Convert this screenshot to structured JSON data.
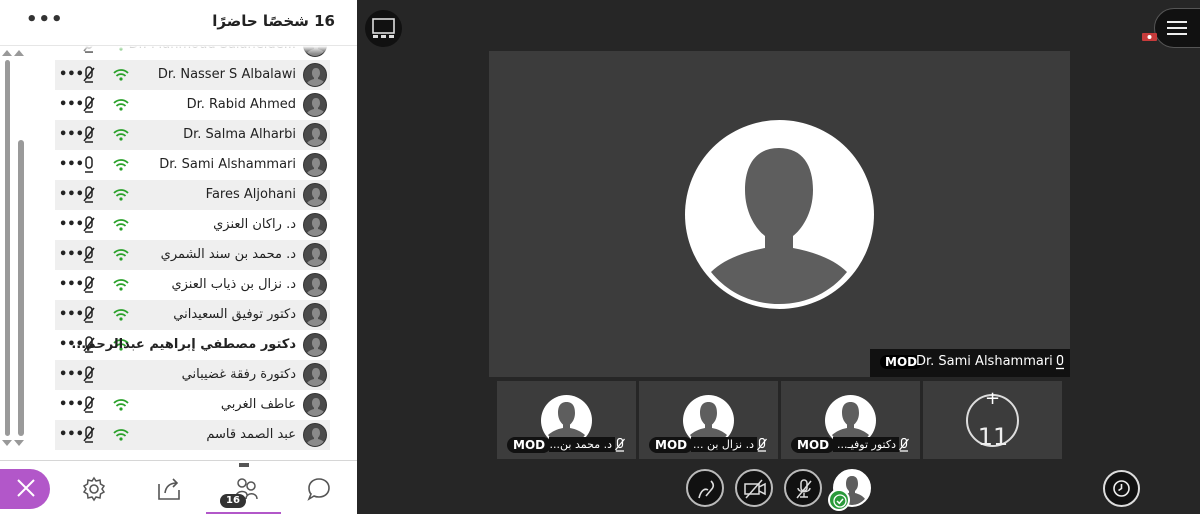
{
  "panel": {
    "title": "16 شخصًا حاضرًا",
    "more_label": "•••",
    "participants": [
      {
        "name": "Dr. Mahmoud Salahelde...",
        "rtl": false,
        "bold": false,
        "wifi": "green"
      },
      {
        "name": "Dr. Nasser S Albalawi",
        "rtl": false,
        "bold": false,
        "wifi": "green"
      },
      {
        "name": "Dr. Rabid Ahmed",
        "rtl": false,
        "bold": false,
        "wifi": "green"
      },
      {
        "name": "Dr. Salma Alharbi",
        "rtl": false,
        "bold": false,
        "wifi": "green"
      },
      {
        "name": "Dr. Sami Alshammari",
        "rtl": false,
        "bold": false,
        "wifi": "green",
        "mic_on": true
      },
      {
        "name": "Fares Aljohani",
        "rtl": false,
        "bold": false,
        "wifi": "green"
      },
      {
        "name": "د. راكان العنزي",
        "rtl": true,
        "bold": false,
        "wifi": "green"
      },
      {
        "name": "د. محمد بن سند الشمري",
        "rtl": true,
        "bold": false,
        "wifi": "green"
      },
      {
        "name": "د. نزال بن ذياب العنزي",
        "rtl": true,
        "bold": false,
        "wifi": "green"
      },
      {
        "name": "دكتور توفيق السعيداني",
        "rtl": true,
        "bold": false,
        "wifi": "green"
      },
      {
        "name": "دكتور مصطفي إبراهيم عبدالرحم...",
        "rtl": true,
        "bold": true,
        "wifi": "green"
      },
      {
        "name": "دكتورة رفقة غضيباني",
        "rtl": true,
        "bold": false,
        "wifi": "none"
      },
      {
        "name": "عاطف الغربي",
        "rtl": true,
        "bold": false,
        "wifi": "green"
      },
      {
        "name": "عبد الصمد قاسم",
        "rtl": true,
        "bold": false,
        "wifi": "green"
      }
    ],
    "row_dots": "•••",
    "attendee_badge": "16"
  },
  "stage": {
    "main_speaker": {
      "mod": "MOD",
      "name": "Dr. Sami Alshammari"
    },
    "thumbnails": [
      {
        "mod": "MOD",
        "name": "د. محمد بن..."
      },
      {
        "mod": "MOD",
        "name": "د. نزال بن ..."
      },
      {
        "mod": "MOD",
        "name": "دكتور توفيـ..."
      }
    ],
    "more_thumb": {
      "plus": "+",
      "count": "11"
    }
  },
  "colors": {
    "accent": "#b257c9",
    "wifi": "#2aa12a",
    "stage_bg": "#262626",
    "tile_bg": "#3c3c3c",
    "check": "#2a9a3a"
  },
  "icons": [
    "close-icon",
    "settings-gear-icon",
    "share-content-icon",
    "attendees-icon",
    "chat-icon",
    "layout-icon",
    "menu-icon",
    "record-icon",
    "microphone-muted-icon",
    "wifi-signal-icon",
    "status-icon",
    "camera-off-icon",
    "mic-off-icon",
    "timer-icon",
    "check-icon"
  ]
}
